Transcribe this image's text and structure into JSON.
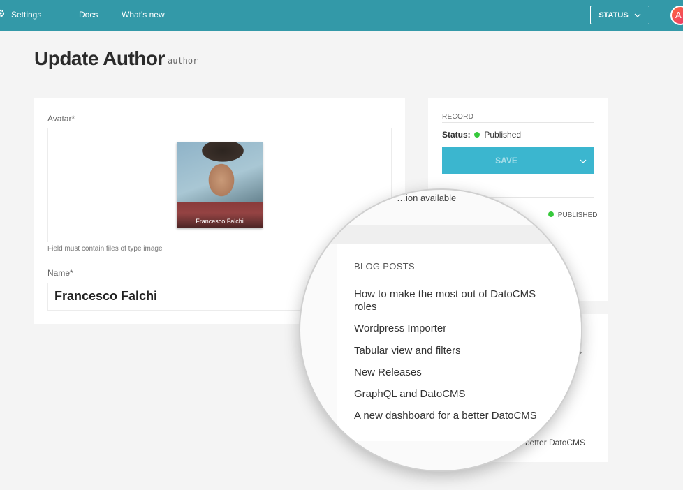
{
  "topbar": {
    "settings_label": "Settings",
    "docs_label": "Docs",
    "whats_new_label": "What's new",
    "status_label": "STATUS",
    "avatar_initial": "A",
    "color": "#3399a8"
  },
  "page": {
    "title": "Update Author",
    "api_key": "author"
  },
  "form": {
    "avatar_label": "Avatar*",
    "avatar_caption": "Francesco Falchi",
    "avatar_hint": "Field must contain files of type image",
    "name_label": "Name*",
    "name_value": "Francesco Falchi"
  },
  "sidebar": {
    "record_title": "RECORD",
    "status_label": "Status:",
    "status_value": "Published",
    "save_label": "SAVE",
    "version_link": "version available",
    "published_label": "PUBLISHED",
    "partial_s": "s",
    "partial_dashboard": "better DatoCMS",
    "status_color": "#37c93c"
  },
  "magnifier": {
    "section_title": "BLOG POSTS",
    "link_text": "…ion available",
    "items": [
      "How to make the most out of DatoCMS roles",
      "Wordpress Importer",
      "Tabular view and filters",
      "New Releases",
      "GraphQL and DatoCMS",
      "A new dashboard for a better DatoCMS"
    ]
  }
}
